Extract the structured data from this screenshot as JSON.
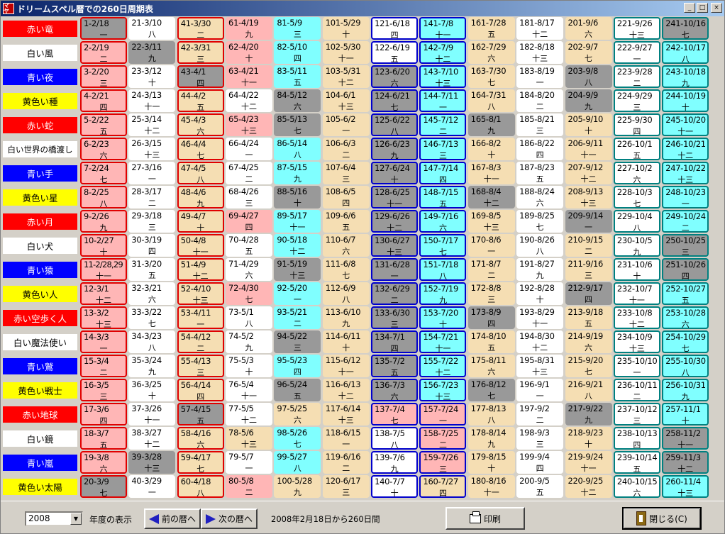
{
  "window": {
    "title": "ドリームスペル暦での260日周期表",
    "icon_text": "マヤ",
    "controls": {
      "minimize": "_",
      "maximize": "□",
      "close": "×"
    }
  },
  "colors": {
    "label_red": "#ff0000",
    "label_white": "#ffffff",
    "label_blue": "#0000ff",
    "label_yellow": "#ffff00",
    "cell_pink": "#ffb6b6",
    "cell_white": "#ffffff",
    "cell_wheat": "#f5deb3",
    "cell_cyan": "#80ffff",
    "cell_gray": "#999999",
    "border_red": "#e00000",
    "border_blue": "#0000cc",
    "border_teal": "#008080"
  },
  "seal_labels": [
    {
      "text": "赤い竜",
      "color": "red"
    },
    {
      "text": "白い風",
      "color": "white"
    },
    {
      "text": "青い夜",
      "color": "blue"
    },
    {
      "text": "黄色い種",
      "color": "yellow"
    },
    {
      "text": "赤い蛇",
      "color": "red"
    },
    {
      "text": "白い世界の橋渡し",
      "color": "white"
    },
    {
      "text": "青い手",
      "color": "blue"
    },
    {
      "text": "黄色い星",
      "color": "yellow"
    },
    {
      "text": "赤い月",
      "color": "red"
    },
    {
      "text": "白い犬",
      "color": "white"
    },
    {
      "text": "青い猿",
      "color": "blue"
    },
    {
      "text": "黄色い人",
      "color": "yellow"
    },
    {
      "text": "赤い空歩く人",
      "color": "red"
    },
    {
      "text": "白い魔法使い",
      "color": "white"
    },
    {
      "text": "青い鷲",
      "color": "blue"
    },
    {
      "text": "黄色い戦士",
      "color": "yellow"
    },
    {
      "text": "赤い地球",
      "color": "red"
    },
    {
      "text": "白い鏡",
      "color": "white"
    },
    {
      "text": "青い嵐",
      "color": "blue"
    },
    {
      "text": "黄色い太陽",
      "color": "yellow"
    }
  ],
  "tones": [
    "一",
    "二",
    "三",
    "四",
    "五",
    "六",
    "七",
    "八",
    "九",
    "十",
    "十一",
    "十二",
    "十三"
  ],
  "column_styles": [
    {
      "fill": "pink",
      "border": "red"
    },
    {
      "fill": "white",
      "border": "none"
    },
    {
      "fill": "wheat",
      "border": "red"
    },
    {
      "fill": "pink",
      "border": "none"
    },
    {
      "fill": "cyan",
      "border": "none"
    },
    {
      "fill": "wheat",
      "border": "none"
    },
    {
      "fill": "white",
      "border": "blue"
    },
    {
      "fill": "cyan",
      "border": "blue"
    },
    {
      "fill": "wheat",
      "border": "none"
    },
    {
      "fill": "white",
      "border": "none"
    },
    {
      "fill": "wheat",
      "border": "none"
    },
    {
      "fill": "white",
      "border": "teal"
    },
    {
      "fill": "cyan",
      "border": "teal"
    }
  ],
  "column_gray_overrides": [
    [
      0,
      19
    ],
    [
      1,
      18
    ],
    [
      2,
      16
    ],
    [],
    [
      3,
      4,
      7,
      10,
      13,
      15
    ],
    [],
    [
      2,
      3,
      4,
      5,
      6,
      7,
      8,
      9,
      10,
      11,
      12,
      13,
      14,
      15
    ],
    [],
    [
      4,
      7,
      12,
      15
    ],
    [],
    [
      2,
      3,
      8,
      11,
      16
    ],
    [],
    [
      0,
      9,
      10,
      17,
      18
    ]
  ],
  "column_pink_overrides": [
    [],
    [],
    [],
    [],
    [],
    [],
    [
      4,
      15,
      16
    ],
    [
      16,
      17,
      18
    ],
    [],
    [],
    [],
    [],
    []
  ],
  "column_wheat_overrides": [
    [],
    [],
    [],
    [
      17
    ],
    [
      16,
      19
    ],
    [],
    [],
    [
      19
    ],
    [
      0,
      1,
      2,
      3,
      5,
      6,
      8,
      10,
      14,
      16
    ],
    [],
    [
      0,
      3,
      11,
      15,
      17,
      18,
      19
    ],
    [],
    []
  ],
  "column_white_overrides": [
    [],
    [],
    [],
    [
      3,
      5,
      6,
      7,
      9,
      10,
      12,
      13,
      14,
      15,
      16,
      17,
      18
    ],
    [],
    [],
    [],
    [],
    [],
    [],
    [],
    [],
    []
  ],
  "dates": [
    [
      "2/18",
      "2/19",
      "2/20",
      "2/21",
      "2/22",
      "2/23",
      "2/24",
      "2/25",
      "2/26",
      "2/27",
      "2/28,29",
      "3/1",
      "3/2",
      "3/3",
      "3/4",
      "3/5",
      "3/6",
      "3/7",
      "3/8",
      "3/9"
    ],
    [
      "3/10",
      "3/11",
      "3/12",
      "3/13",
      "3/14",
      "3/15",
      "3/16",
      "3/17",
      "3/18",
      "3/19",
      "3/20",
      "3/21",
      "3/22",
      "3/23",
      "3/24",
      "3/25",
      "3/26",
      "3/27",
      "3/28",
      "3/29"
    ],
    [
      "3/30",
      "3/31",
      "4/1",
      "4/2",
      "4/3",
      "4/4",
      "4/5",
      "4/6",
      "4/7",
      "4/8",
      "4/9",
      "4/10",
      "4/11",
      "4/12",
      "4/13",
      "4/14",
      "4/15",
      "4/16",
      "4/17",
      "4/18"
    ],
    [
      "4/19",
      "4/20",
      "4/21",
      "4/22",
      "4/23",
      "4/24",
      "4/25",
      "4/26",
      "4/27",
      "4/28",
      "4/29",
      "4/30",
      "5/1",
      "5/2",
      "5/3",
      "5/4",
      "5/5",
      "5/6",
      "5/7",
      "5/8"
    ],
    [
      "5/9",
      "5/10",
      "5/11",
      "5/12",
      "5/13",
      "5/14",
      "5/15",
      "5/16",
      "5/17",
      "5/18",
      "5/19",
      "5/20",
      "5/21",
      "5/22",
      "5/23",
      "5/24",
      "5/25",
      "5/26",
      "5/27",
      "5/28"
    ],
    [
      "5/29",
      "5/30",
      "5/31",
      "6/1",
      "6/2",
      "6/3",
      "6/4",
      "6/5",
      "6/6",
      "6/7",
      "6/8",
      "6/9",
      "6/10",
      "6/11",
      "6/12",
      "6/13",
      "6/14",
      "6/15",
      "6/16",
      "6/17"
    ],
    [
      "6/18",
      "6/19",
      "6/20",
      "6/21",
      "6/22",
      "6/23",
      "6/24",
      "6/25",
      "6/26",
      "6/27",
      "6/28",
      "6/29",
      "6/30",
      "7/1",
      "7/2",
      "7/3",
      "7/4",
      "7/5",
      "7/6",
      "7/7"
    ],
    [
      "7/8",
      "7/9",
      "7/10",
      "7/11",
      "7/12",
      "7/13",
      "7/14",
      "7/15",
      "7/16",
      "7/17",
      "7/18",
      "7/19",
      "7/20",
      "7/21",
      "7/22",
      "7/23",
      "7/24",
      "7/25",
      "7/26",
      "7/27"
    ],
    [
      "7/28",
      "7/29",
      "7/30",
      "7/31",
      "8/1",
      "8/2",
      "8/3",
      "8/4",
      "8/5",
      "8/6",
      "8/7",
      "8/8",
      "8/9",
      "8/10",
      "8/11",
      "8/12",
      "8/13",
      "8/14",
      "8/15",
      "8/16"
    ],
    [
      "8/17",
      "8/18",
      "8/19",
      "8/20",
      "8/21",
      "8/22",
      "8/23",
      "8/24",
      "8/25",
      "8/26",
      "8/27",
      "8/28",
      "8/29",
      "8/30",
      "8/31",
      "9/1",
      "9/2",
      "9/3",
      "9/4",
      "9/5"
    ],
    [
      "9/6",
      "9/7",
      "9/8",
      "9/9",
      "9/10",
      "9/11",
      "9/12",
      "9/13",
      "9/14",
      "9/15",
      "9/16",
      "9/17",
      "9/18",
      "9/19",
      "9/20",
      "9/21",
      "9/22",
      "9/23",
      "9/24",
      "9/25"
    ],
    [
      "9/26",
      "9/27",
      "9/28",
      "9/29",
      "9/30",
      "10/1",
      "10/2",
      "10/3",
      "10/4",
      "10/5",
      "10/6",
      "10/7",
      "10/8",
      "10/9",
      "10/10",
      "10/11",
      "10/12",
      "10/13",
      "10/14",
      "10/15"
    ],
    [
      "10/16",
      "10/17",
      "10/18",
      "10/19",
      "10/20",
      "10/21",
      "10/22",
      "10/23",
      "10/24",
      "10/25",
      "10/26",
      "10/27",
      "10/28",
      "10/29",
      "10/30",
      "10/31",
      "11/1",
      "11/2",
      "11/3",
      "11/4"
    ]
  ],
  "toolbar": {
    "year_value": "2008",
    "year_display_label": "年度の表示",
    "prev_label": "前の暦へ",
    "next_label": "次の暦へ",
    "range_text": "2008年2月18日から260日間",
    "print_label": "印刷",
    "close_label": "閉じる(C)"
  }
}
